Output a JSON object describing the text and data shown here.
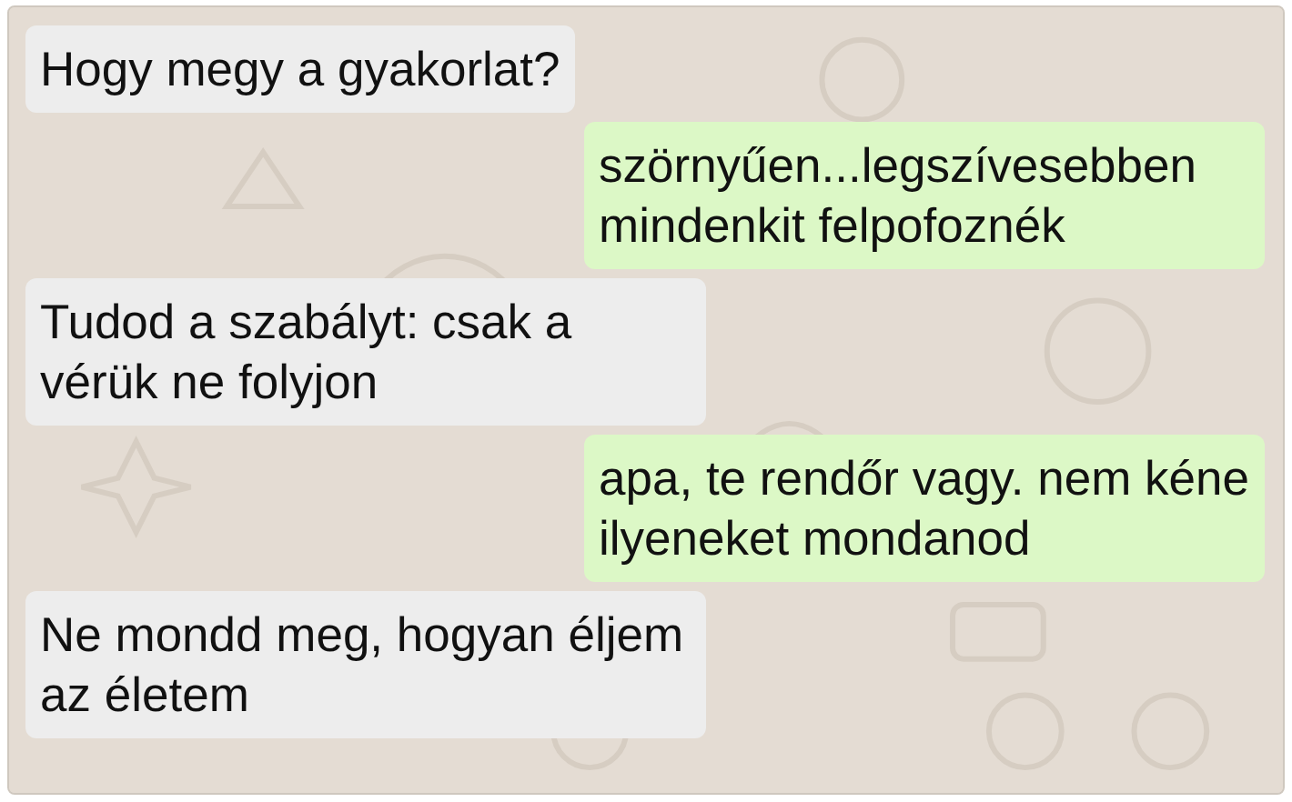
{
  "messages": [
    {
      "kind": "incoming",
      "text": "Hogy megy a gyakorlat?"
    },
    {
      "kind": "outgoing",
      "text": "szörnyűen...legszívesebben mindenkit felpofoznék"
    },
    {
      "kind": "incoming",
      "text": "Tudod a szabályt: csak a vérük ne folyjon"
    },
    {
      "kind": "outgoing",
      "text": "apa, te rendőr vagy. nem kéne ilyeneket mondanod"
    },
    {
      "kind": "incoming",
      "text": "Ne mondd meg, hogyan éljem az életem"
    }
  ]
}
